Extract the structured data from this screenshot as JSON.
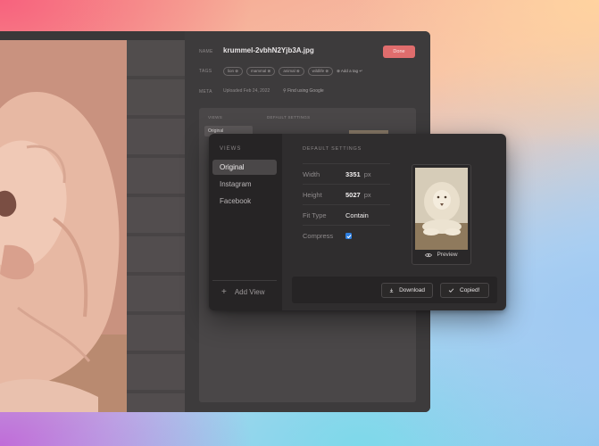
{
  "background_window": {
    "name_label": "NAME",
    "filename": "krummel-2vbhN2Yjb3A.jpg",
    "done_label": "Done",
    "tags_label": "TAGS",
    "tags": [
      "lion ⊗",
      "mammal ⊗",
      "animal ⊗",
      "wildlife ⊗"
    ],
    "add_tag": "⊕ Add a tag ↵",
    "meta_label": "META",
    "uploaded": "Uploaded Feb 24, 2022",
    "find_google": "Find using Google",
    "views_label": "VIEWS",
    "default_settings_label": "DEFAULT SETTINGS",
    "original": "Original"
  },
  "dialog": {
    "views_title": "VIEWS",
    "views": [
      {
        "label": "Original",
        "active": true
      },
      {
        "label": "Instagram",
        "active": false
      },
      {
        "label": "Facebook",
        "active": false
      }
    ],
    "add_view": "Add View",
    "settings_title": "DEFAULT SETTINGS",
    "width_label": "Width",
    "width_value": "3351",
    "width_unit": "px",
    "height_label": "Height",
    "height_value": "5027",
    "height_unit": "px",
    "fit_label": "Fit Type",
    "fit_value": "Contain",
    "compress_label": "Compress",
    "compress_checked": true,
    "preview_label": "Preview",
    "download_label": "Download",
    "copied_label": "Copied!"
  },
  "colors": {
    "accent_done": "#e06d6d",
    "checkbox": "#2f7fe0",
    "dialog_bg": "#2f2d2e"
  }
}
